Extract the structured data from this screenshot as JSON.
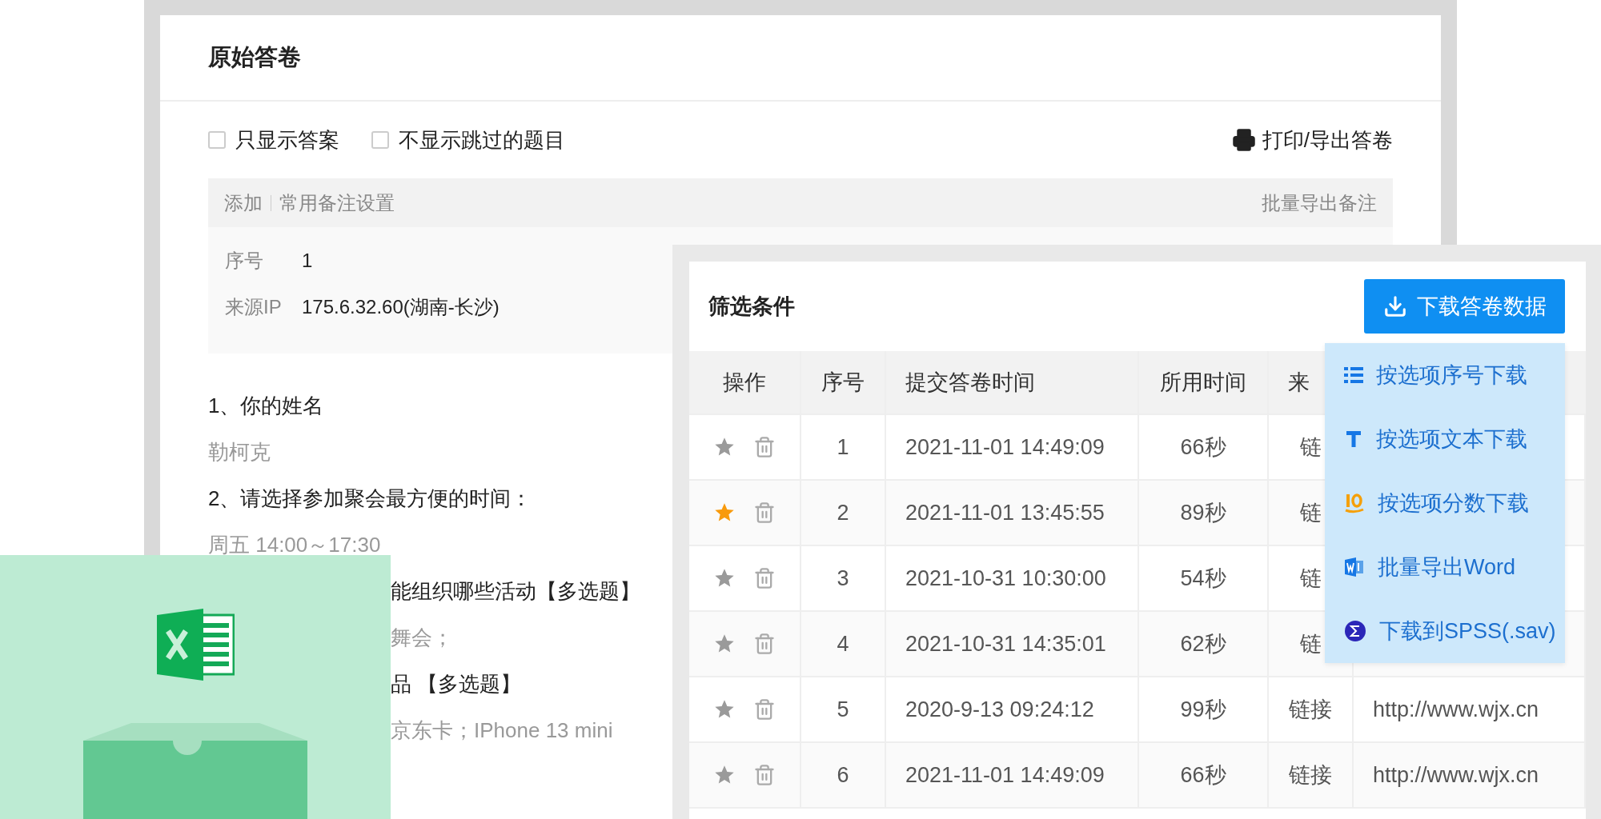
{
  "answer_sheet": {
    "title": "原始答卷",
    "filters": [
      {
        "label": "只显示答案",
        "checked": false
      },
      {
        "label": "不显示跳过的题目",
        "checked": false
      }
    ],
    "print_link": "打印/导出答卷",
    "note_bar": {
      "add": "添加",
      "settings": "常用备注设置",
      "export": "批量导出备注"
    },
    "info": [
      {
        "label": "序号",
        "value": "1"
      },
      {
        "label": "来源IP",
        "value": "175.6.32.60(湖南-长沙)"
      }
    ],
    "lines": [
      {
        "kind": "question",
        "text": "1、你的姓名"
      },
      {
        "kind": "answer",
        "text": "勒柯克"
      },
      {
        "kind": "question",
        "text": "2、请选择参加聚会最方便的时间："
      },
      {
        "kind": "answer",
        "text": "周五 14:00～17:30"
      }
    ],
    "covered_lines": [
      {
        "kind": "question",
        "text": "能组织哪些活动【多选题】"
      },
      {
        "kind": "answer",
        "text": "舞会；"
      },
      {
        "kind": "question",
        "text": "品 【多选题】"
      },
      {
        "kind": "answer",
        "text": "京东卡；IPhone 13 mini"
      }
    ]
  },
  "results": {
    "title": "筛选条件",
    "download_button": "下载答卷数据",
    "columns": [
      "操作",
      "序号",
      "提交答卷时间",
      "所用时间",
      "来"
    ],
    "rows": [
      {
        "starred": false,
        "no": "1",
        "time": "2021-11-01 14:49:09",
        "duration": "66秒",
        "source": "链"
      },
      {
        "starred": true,
        "no": "2",
        "time": "2021-11-01 13:45:55",
        "duration": "89秒",
        "source": "链"
      },
      {
        "starred": false,
        "no": "3",
        "time": "2021-10-31 10:30:00",
        "duration": "54秒",
        "source": "链"
      },
      {
        "starred": false,
        "no": "4",
        "time": "2021-10-31 14:35:01",
        "duration": "62秒",
        "source": "链"
      },
      {
        "starred": false,
        "no": "5",
        "time": "2020-9-13 09:24:12",
        "duration": "99秒",
        "source": "链接",
        "url": "http://www.wjx.cn"
      },
      {
        "starred": false,
        "no": "6",
        "time": "2021-11-01 14:49:09",
        "duration": "66秒",
        "source": "链接",
        "url": "http://www.wjx.cn"
      }
    ],
    "download_menu": [
      {
        "kind": "list",
        "label": "按选项序号下载"
      },
      {
        "kind": "text",
        "label": "按选项文本下载"
      },
      {
        "kind": "score",
        "label": "按选项分数下载"
      },
      {
        "kind": "word",
        "label": "批量导出Word"
      },
      {
        "kind": "spss",
        "label": "下载到SPSS(.sav)"
      }
    ]
  }
}
